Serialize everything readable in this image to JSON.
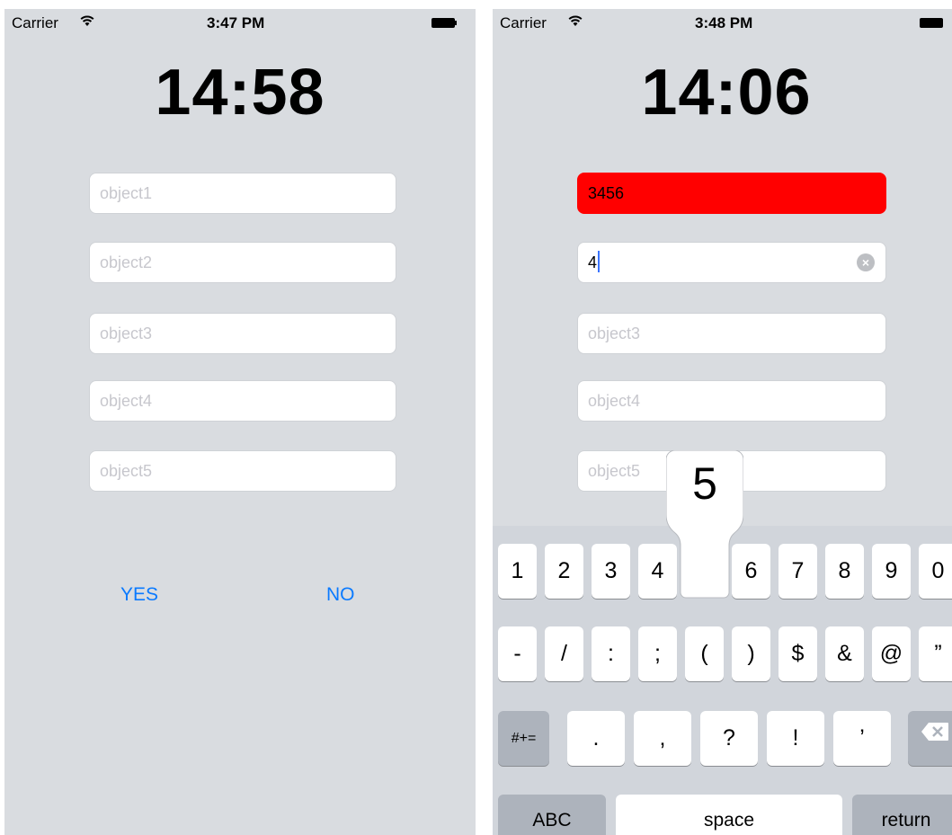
{
  "left": {
    "status": {
      "carrier": "Carrier",
      "time": "3:47 PM"
    },
    "clock": "14:58",
    "fields": [
      {
        "value": "",
        "placeholder": "object1"
      },
      {
        "value": "",
        "placeholder": "object2"
      },
      {
        "value": "",
        "placeholder": "object3"
      },
      {
        "value": "",
        "placeholder": "object4"
      },
      {
        "value": "",
        "placeholder": "object5"
      }
    ],
    "yes_label": "YES",
    "no_label": "NO"
  },
  "right": {
    "status": {
      "carrier": "Carrier",
      "time": "3:48 PM"
    },
    "clock": "14:06",
    "fields": [
      {
        "value": "3456",
        "placeholder": "",
        "state": "error"
      },
      {
        "value": "4",
        "placeholder": "",
        "state": "editing"
      },
      {
        "value": "",
        "placeholder": "object3"
      },
      {
        "value": "",
        "placeholder": "object4"
      },
      {
        "value": "",
        "placeholder": "object5"
      }
    ],
    "keyboard": {
      "row1": [
        "1",
        "2",
        "3",
        "4",
        "",
        "6",
        "7",
        "8",
        "9",
        "0"
      ],
      "row2": [
        "-",
        "/",
        ":",
        ";",
        "(",
        ")",
        "$",
        "&",
        "@",
        "”"
      ],
      "row3_mode": "#+=",
      "row3": [
        ".",
        ",",
        "?",
        "!",
        "’"
      ],
      "abc": "ABC",
      "space": "space",
      "return": "return",
      "popup_key": "5"
    }
  },
  "colors": {
    "accent": "#0a7aff",
    "error": "#ff0000",
    "caret": "#3a74ff"
  },
  "icons": [
    "wifi-icon",
    "battery-icon",
    "clear-icon",
    "delete-icon"
  ]
}
